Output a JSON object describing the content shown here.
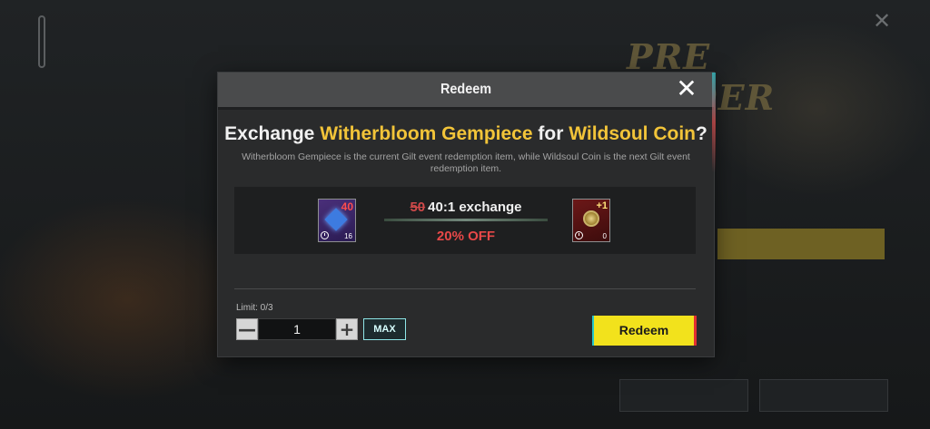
{
  "background": {
    "preorder_text": "PRE ORDER"
  },
  "dialog": {
    "title": "Redeem",
    "close_icon": "✕",
    "heading": {
      "prefix": "Exchange ",
      "item_from": "Witherbloom Gempiece",
      "middle": " for ",
      "item_to": "Wildsoul Coin",
      "suffix": "?"
    },
    "description": "Witherbloom Gempiece is the current Gilt event redemption item, while Wildsoul Coin is the next Gilt event redemption item.",
    "exchange": {
      "from_tile": {
        "count": "40",
        "owned": "16",
        "icon": "gem-icon"
      },
      "to_tile": {
        "count": "+1",
        "owned": "0",
        "icon": "coin-icon"
      },
      "old_rate": "50",
      "rate": "40:1 exchange",
      "discount": "20% OFF"
    },
    "limit": "Limit: 0/3",
    "quantity": "1",
    "minus_label": "—",
    "plus_label": "+",
    "max_label": "MAX",
    "redeem_label": "Redeem"
  },
  "colors": {
    "highlight": "#f2c439",
    "discount": "#e74848",
    "redeem_button": "#f2e21c",
    "max_border": "#8ee6e8"
  }
}
